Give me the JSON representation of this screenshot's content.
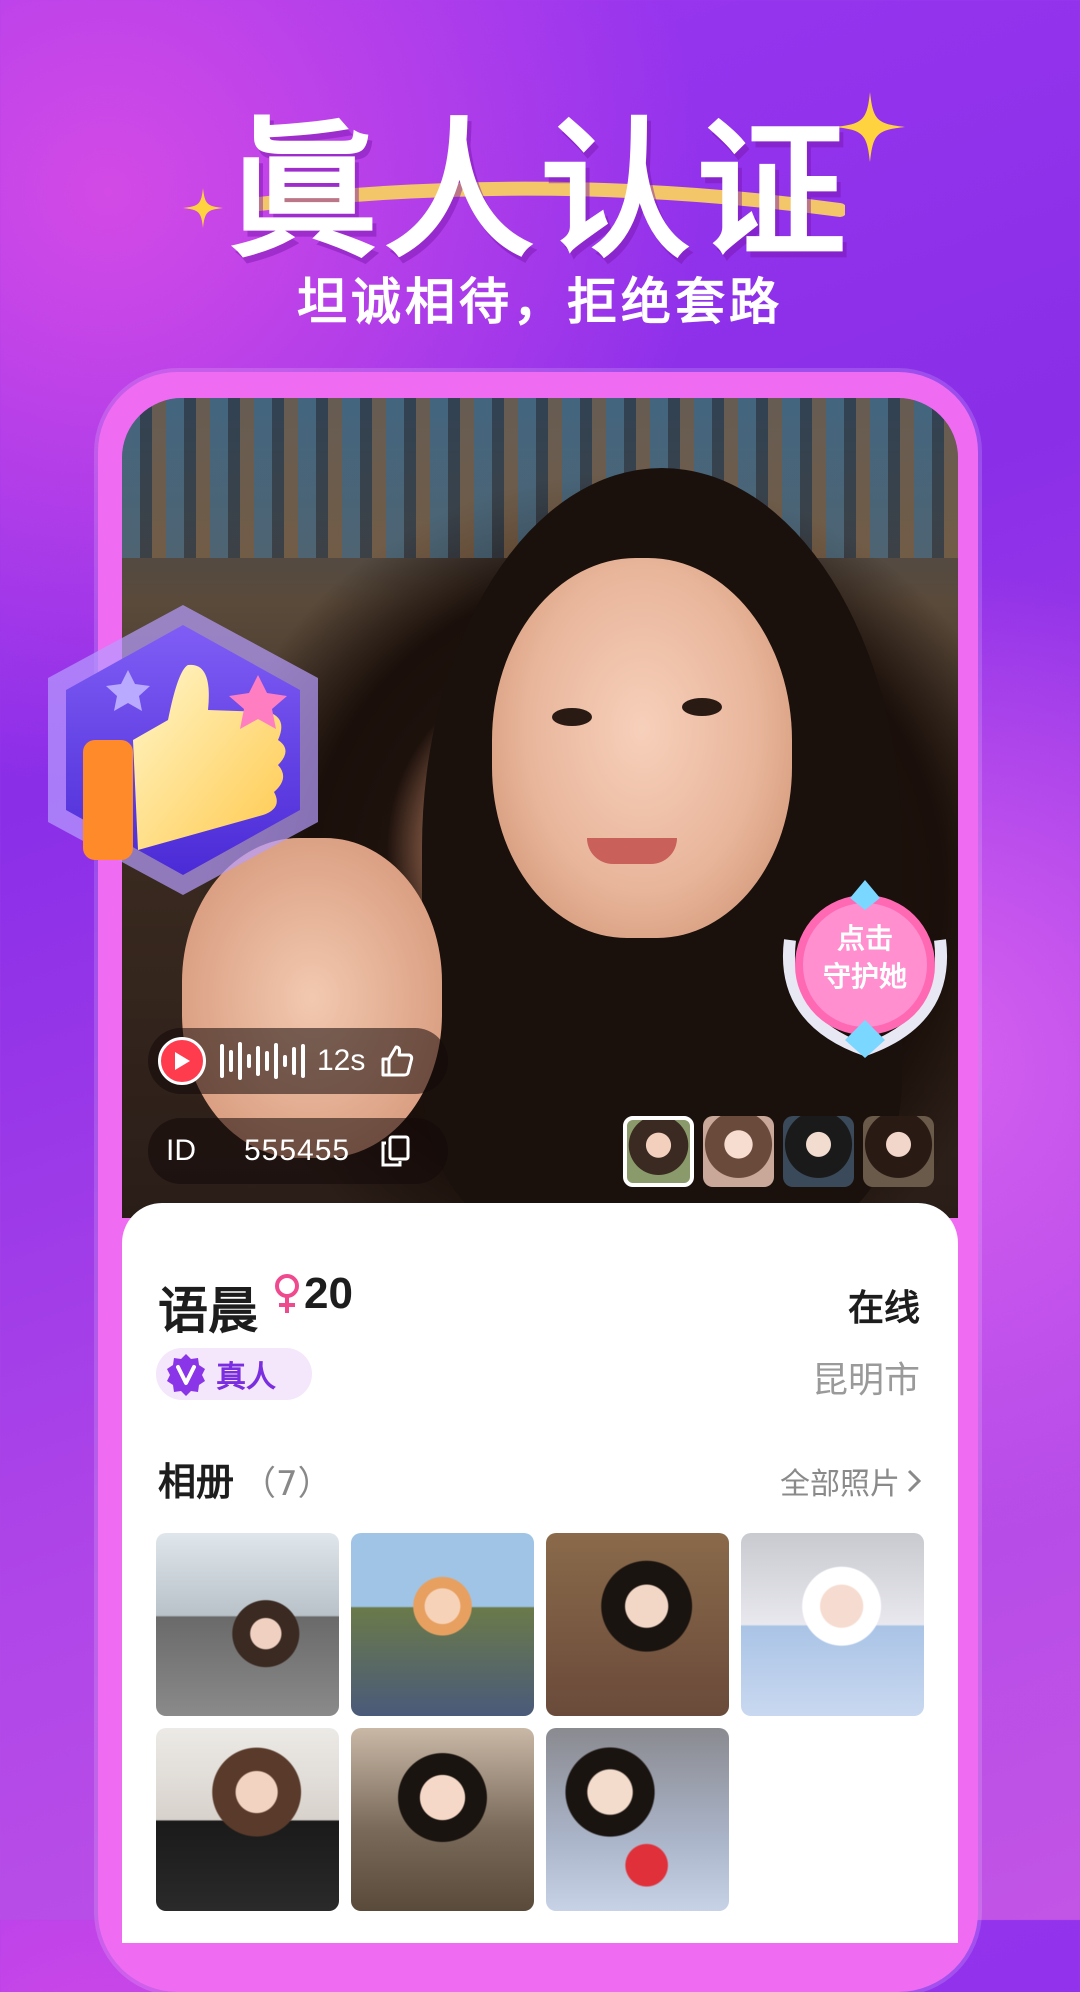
{
  "banner": {
    "title": "眞人认证",
    "subtitle": "坦诚相待，拒绝套路"
  },
  "profile": {
    "voice_duration": "12s",
    "id_label": "ID",
    "id_value": "555455",
    "guard_line1": "点击",
    "guard_line2": "守护她",
    "name": "语晨",
    "age": "20",
    "status": "在线",
    "verified_label": "真人",
    "city": "昆明市"
  },
  "album": {
    "title": "相册",
    "count": "（7）",
    "all_photos": "全部照片"
  },
  "colors": {
    "accent_pink": "#ef6cf2",
    "verify_purple": "#7a2ee0",
    "play_red": "#ff3b4e"
  }
}
